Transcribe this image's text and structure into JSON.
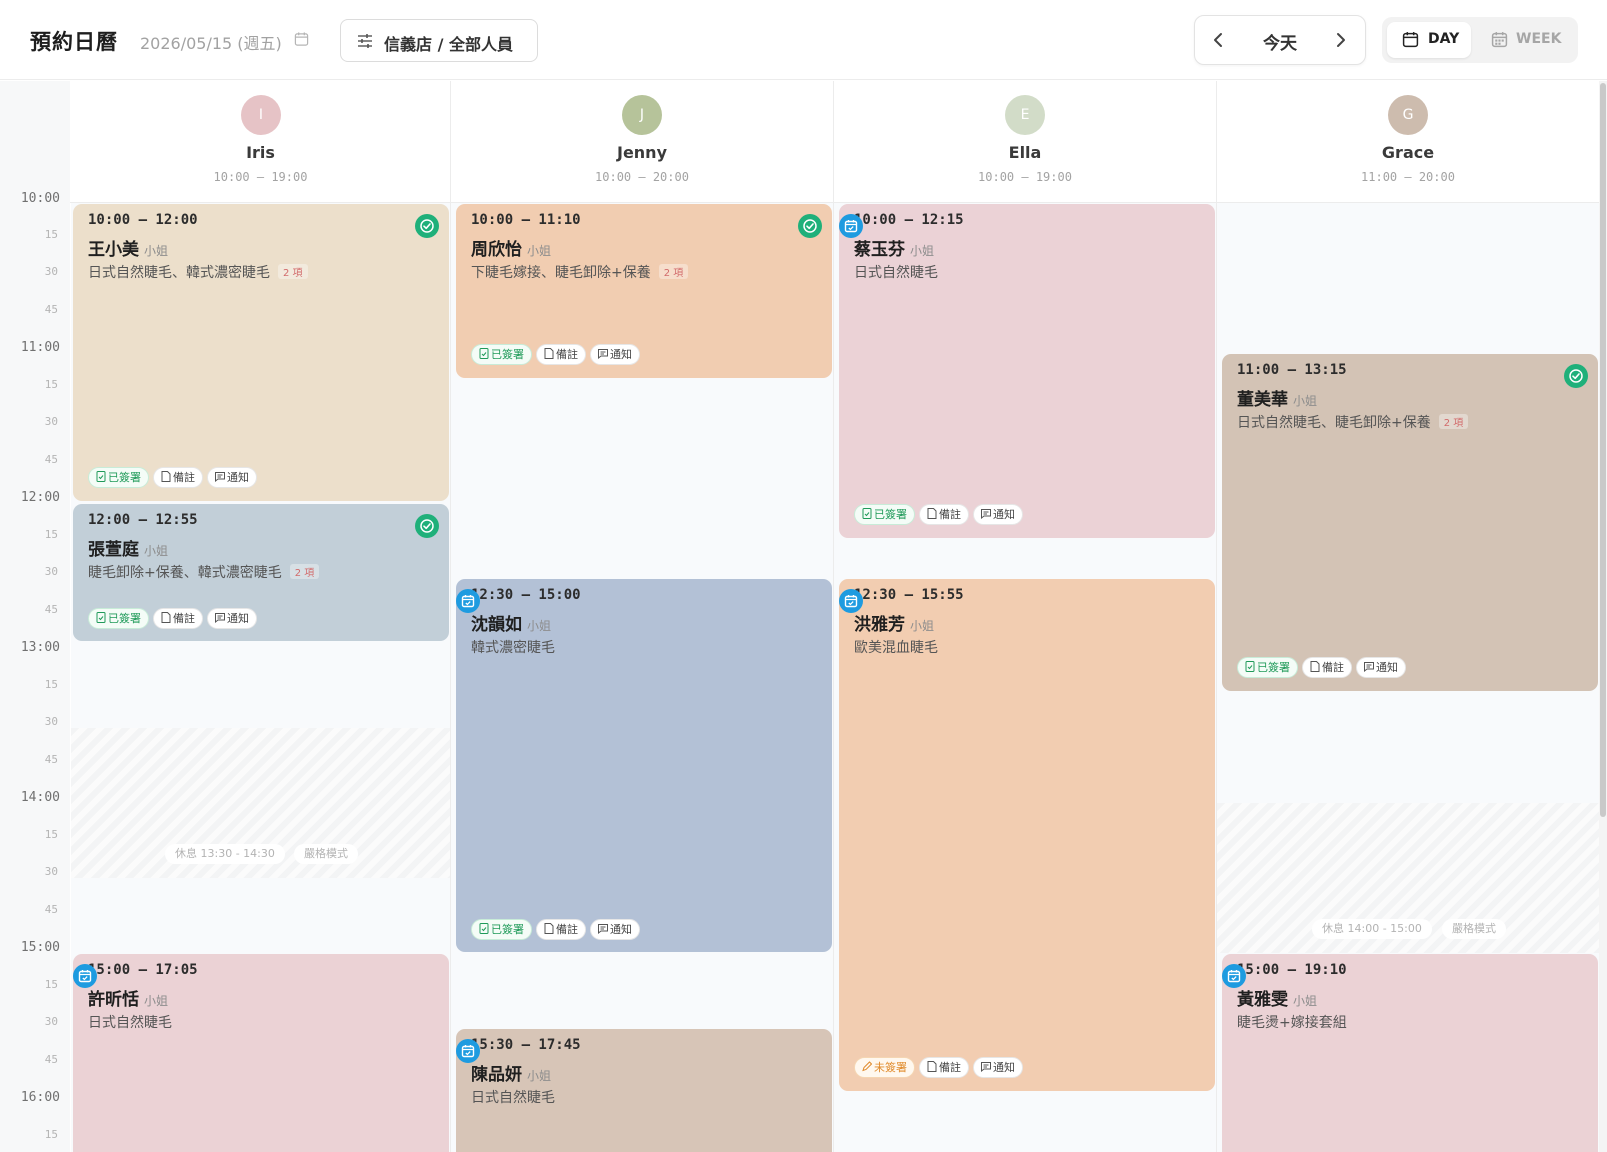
{
  "header": {
    "title": "預約日曆",
    "date": "2026/05/15 (週五)",
    "filter_label": "信義店 / 全部人員",
    "today_label": "今天",
    "view_day": "DAY",
    "view_week": "WEEK",
    "active_view": "DAY"
  },
  "time_labels": {
    "t1000": "10:00",
    "t1015": "15",
    "t1030": "30",
    "t1045": "45",
    "t1100": "11:00",
    "t1115": "15",
    "t1130": "30",
    "t1145": "45",
    "t1200": "12:00",
    "t1215": "15",
    "t1230": "30",
    "t1245": "45",
    "t1300": "13:00",
    "t1315": "15",
    "t1330": "30",
    "t1345": "45",
    "t1400": "14:00",
    "t1415": "15",
    "t1430": "30",
    "t1445": "45",
    "t1500": "15:00",
    "t1515": "15",
    "t1530": "30",
    "t1545": "45",
    "t1600": "16:00",
    "t1615": "15"
  },
  "staff": [
    {
      "initial": "I",
      "name": "Iris",
      "hours": "10:00 – 19:00",
      "avatar_color": "#e6c3c6"
    },
    {
      "initial": "J",
      "name": "Jenny",
      "hours": "10:00 – 20:00",
      "avatar_color": "#b6c39a"
    },
    {
      "initial": "E",
      "name": "Ella",
      "hours": "10:00 – 19:00",
      "avatar_color": "#d2dcc8"
    },
    {
      "initial": "G",
      "name": "Grace",
      "hours": "11:00 – 20:00",
      "avatar_color": "#cdbcae"
    }
  ],
  "breaks": {
    "iris": {
      "label": "休息 13:30 - 14:30",
      "mode": "嚴格模式"
    },
    "grace": {
      "label": "休息 14:00 - 15:00",
      "mode": "嚴格模式"
    }
  },
  "tag_labels": {
    "signed": "已簽署",
    "unsigned": "未簽署",
    "note": "備註",
    "notify": "通知"
  },
  "honorific": "小姐",
  "appointments": {
    "a1": {
      "time": "10:00 – 12:00",
      "client": "王小美",
      "service": "日式自然睫毛、韓式濃密睫毛",
      "count": "2 項",
      "status": "confirmed",
      "signed": true,
      "color": "#ecdfcb"
    },
    "a2": {
      "time": "12:00 – 12:55",
      "client": "張萱庭",
      "service": "睫毛卸除+保養、韓式濃密睫毛",
      "count": "2 項",
      "status": "confirmed",
      "signed": true,
      "color": "#c2cfd8"
    },
    "a3": {
      "time": "15:00 – 17:05",
      "client": "許昕恬",
      "service": "日式自然睫毛",
      "status": "scheduled",
      "color": "#ebd2d5"
    },
    "a4": {
      "time": "10:00 – 11:10",
      "client": "周欣怡",
      "service": "下睫毛嫁接、睫毛卸除+保養",
      "count": "2 項",
      "status": "confirmed",
      "signed": true,
      "color": "#f1cdb1"
    },
    "a5": {
      "time": "12:30 – 15:00",
      "client": "沈韻如",
      "service": "韓式濃密睫毛",
      "status": "scheduled",
      "signed": true,
      "color": "#b3c1d6"
    },
    "a6": {
      "time": "15:30 – 17:45",
      "client": "陳品妍",
      "service": "日式自然睫毛",
      "status": "scheduled",
      "color": "#d7c5b7"
    },
    "a7": {
      "time": "10:00 – 12:15",
      "client": "蔡玉芬",
      "service": "日式自然睫毛",
      "status": "scheduled",
      "signed": true,
      "color": "#ebd2d6"
    },
    "a8": {
      "time": "12:30 – 15:55",
      "client": "洪雅芳",
      "service": "歐美混血睫毛",
      "status": "scheduled",
      "signed": false,
      "color": "#f2cdb1"
    },
    "a9": {
      "time": "11:00 – 13:15",
      "client": "董美華",
      "service": "日式自然睫毛、睫毛卸除+保養",
      "count": "2 項",
      "status": "confirmed",
      "signed": true,
      "color": "#d3c3b5"
    },
    "a10": {
      "time": "15:00 – 19:10",
      "client": "黃雅雯",
      "service": "睫毛燙+嫁接套組",
      "status": "scheduled",
      "color": "#ebd2d5"
    }
  }
}
